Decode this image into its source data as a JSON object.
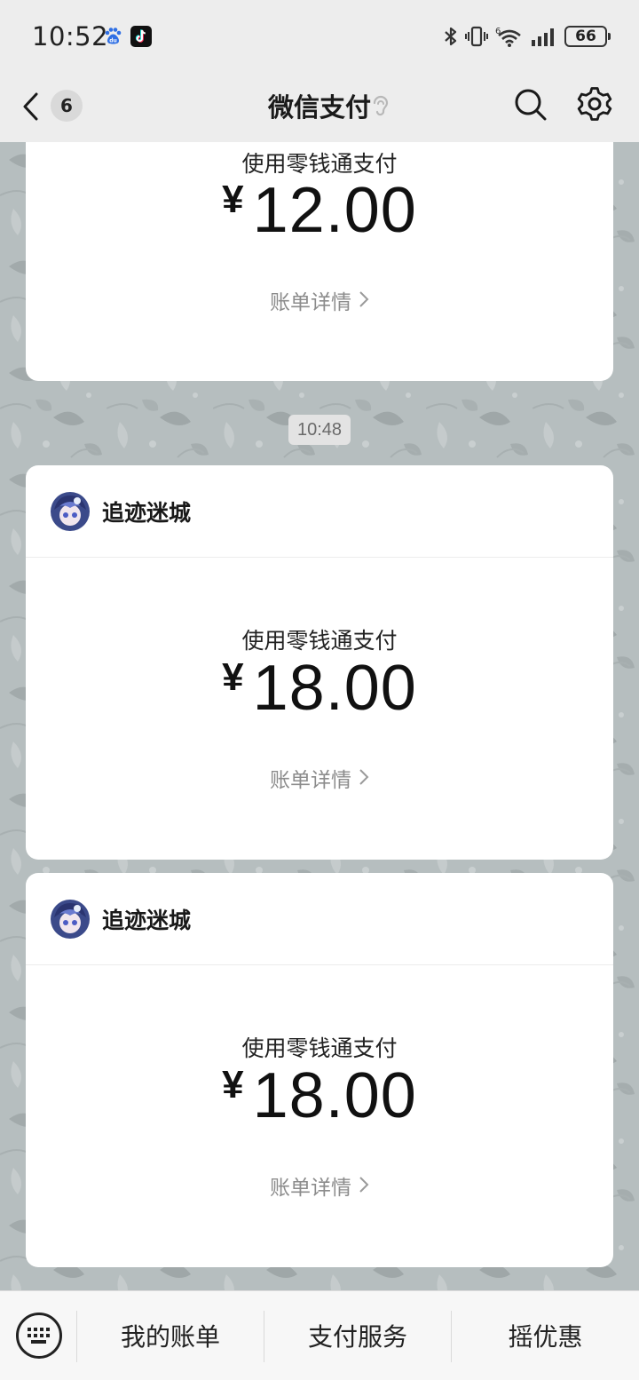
{
  "status_bar": {
    "time": "10:52",
    "battery": "66",
    "network_label": "6",
    "icons": [
      "baidu-app-icon",
      "tiktok-app-icon",
      "bluetooth-icon",
      "vibrate-icon",
      "wifi-icon",
      "signal-icon",
      "battery-icon"
    ]
  },
  "nav": {
    "back_badge": "6",
    "title": "微信支付",
    "icons": [
      "back-arrow-icon",
      "ear-icon",
      "search-icon",
      "gear-icon"
    ]
  },
  "messages": [
    {
      "merchant": "",
      "pay_method": "使用零钱通支付",
      "currency": "¥",
      "amount": "12.00",
      "detail_label": "账单详情"
    },
    {
      "merchant": "追迹迷城",
      "pay_method": "使用零钱通支付",
      "currency": "¥",
      "amount": "18.00",
      "detail_label": "账单详情"
    },
    {
      "merchant": "追迹迷城",
      "pay_method": "使用零钱通支付",
      "currency": "¥",
      "amount": "18.00",
      "detail_label": "账单详情"
    }
  ],
  "timestamp": "10:48",
  "bottom_menu": {
    "items": [
      "我的账单",
      "支付服务",
      "摇优惠"
    ],
    "keyboard_icon": "keyboard-icon"
  },
  "colors": {
    "bar_bg": "#ededed",
    "card_bg": "#ffffff",
    "chat_bg": "#b4bcbd",
    "link_gray": "#8c8c8c"
  }
}
